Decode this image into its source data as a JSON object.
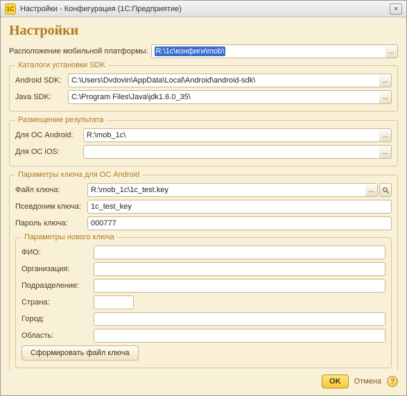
{
  "window": {
    "title": "Настройки - Конфигурация  (1С:Предприятие)"
  },
  "page": {
    "title": "Настройки"
  },
  "platform_path": {
    "label": "Расположение мобильной платформы:",
    "value": "R:\\1с\\конфиги\\mob\\"
  },
  "sdk": {
    "legend": "Каталоги установки SDK",
    "android": {
      "label": "Android SDK:",
      "value": "C:\\Users\\Dvdovin\\AppData\\Local\\Android\\android-sdk\\"
    },
    "java": {
      "label": "Java SDK:",
      "value": "C:\\Program Files\\Java\\jdk1.6.0_35\\"
    }
  },
  "result": {
    "legend": "Размещение результата",
    "android": {
      "label": "Для ОС Android:",
      "value": "R:\\mob_1c\\"
    },
    "ios": {
      "label": "Для ОС iOS:",
      "value": ""
    }
  },
  "key": {
    "legend": "Параметры ключа для ОС Android",
    "file": {
      "label": "Файл ключа:",
      "value": "R:\\mob_1c\\1c_test.key"
    },
    "alias": {
      "label": "Псевдоним ключа:",
      "value": "1c_test_key"
    },
    "pwd": {
      "label": "Пароль ключа:",
      "value": "000777"
    },
    "new": {
      "legend": "Параметры нового ключа",
      "fio": {
        "label": "ФИО:",
        "value": ""
      },
      "org": {
        "label": "Организация:",
        "value": ""
      },
      "dept": {
        "label": "Подразделение:",
        "value": ""
      },
      "country": {
        "label": "Страна:",
        "value": ""
      },
      "city": {
        "label": "Город:",
        "value": ""
      },
      "region": {
        "label": "Область:",
        "value": ""
      },
      "gen_button": "Сформировать файл ключа"
    }
  },
  "footer": {
    "ok": "OK",
    "cancel": "Отмена"
  },
  "icons": {
    "dots": "...",
    "mag": "🔍",
    "close": "×",
    "help": "?"
  }
}
